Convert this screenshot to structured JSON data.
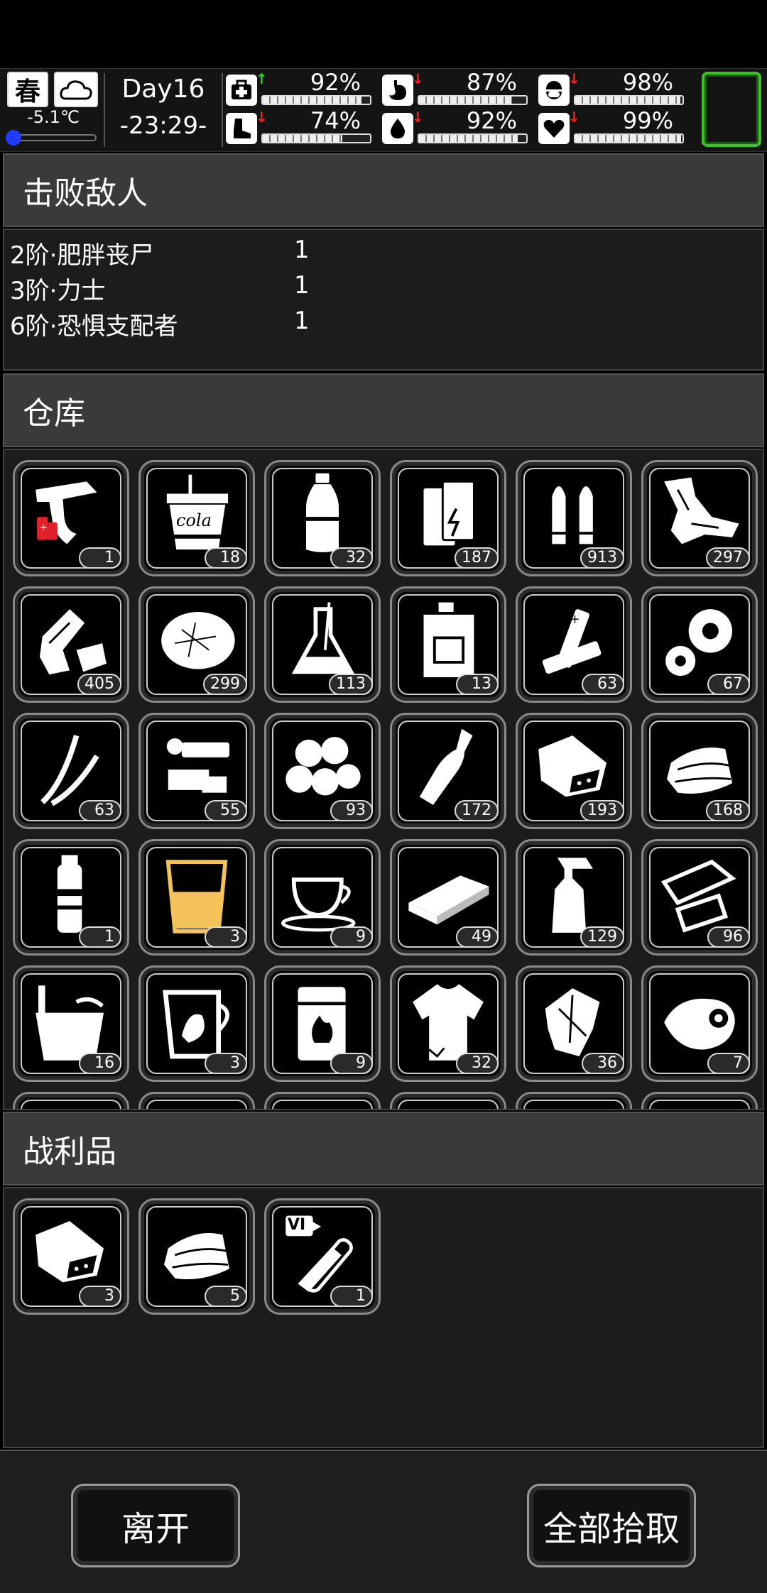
{
  "hud": {
    "season": "春",
    "weather_icon": "cloud-icon",
    "temperature": "-5.1℃",
    "day": "Day16",
    "time": "-23:29-",
    "stats": [
      {
        "name": "health",
        "icon": "medkit-icon",
        "trend": "up",
        "value": "92%",
        "level": 0.92
      },
      {
        "name": "hunger",
        "icon": "stomach-icon",
        "trend": "down",
        "value": "87%",
        "level": 0.87
      },
      {
        "name": "medicine",
        "icon": "pill-icon",
        "trend": "down",
        "value": "98%",
        "level": 0.98
      },
      {
        "name": "stamina",
        "icon": "boot-icon",
        "trend": "down",
        "value": "74%",
        "level": 0.74
      },
      {
        "name": "thirst",
        "icon": "water-drop-icon",
        "trend": "down",
        "value": "92%",
        "level": 0.92
      },
      {
        "name": "mood",
        "icon": "heart-icon",
        "trend": "down",
        "value": "99%",
        "level": 0.99
      }
    ]
  },
  "defeated": {
    "title": "击败敌人",
    "enemies": [
      {
        "name": "2阶·肥胖丧尸",
        "count": "1"
      },
      {
        "name": "3阶·力士",
        "count": "1"
      },
      {
        "name": "6阶·恐惧支配者",
        "count": "1"
      }
    ]
  },
  "storage": {
    "title": "仓库",
    "items": [
      {
        "icon": "flare-gun-icon",
        "qty": "1"
      },
      {
        "icon": "cola-cup-icon",
        "qty": "18",
        "text": "cola"
      },
      {
        "icon": "water-bottle-icon",
        "qty": "32"
      },
      {
        "icon": "battery-pack-icon",
        "qty": "187"
      },
      {
        "icon": "bullets-icon",
        "qty": "913"
      },
      {
        "icon": "scrap-metal-icon",
        "qty": "297"
      },
      {
        "icon": "plastic-waste-icon",
        "qty": "405"
      },
      {
        "icon": "cotton-fluff-icon",
        "qty": "299"
      },
      {
        "icon": "flask-icon",
        "qty": "113"
      },
      {
        "icon": "fuel-canister-icon",
        "qty": "13"
      },
      {
        "icon": "batteries-icon",
        "qty": "63"
      },
      {
        "icon": "gears-icon",
        "qty": "67"
      },
      {
        "icon": "wires-icon",
        "qty": "63"
      },
      {
        "icon": "electronic-parts-icon",
        "qty": "55"
      },
      {
        "icon": "cotton-balls-icon",
        "qty": "93"
      },
      {
        "icon": "glass-bottle-icon",
        "qty": "172"
      },
      {
        "icon": "seed-bag-icon",
        "qty": "193"
      },
      {
        "icon": "cloth-icon",
        "qty": "168"
      },
      {
        "icon": "spray-can-icon",
        "qty": "1"
      },
      {
        "icon": "juice-glass-icon",
        "qty": "3"
      },
      {
        "icon": "coffee-cup-icon",
        "qty": "9"
      },
      {
        "icon": "wood-board-icon",
        "qty": "49"
      },
      {
        "icon": "spray-bottle-icon",
        "qty": "129"
      },
      {
        "icon": "paper-scraps-icon",
        "qty": "96"
      },
      {
        "icon": "bucket-icon",
        "qty": "16"
      },
      {
        "icon": "herb-jar-icon",
        "qty": "3"
      },
      {
        "icon": "fuel-barrel-icon",
        "qty": "9"
      },
      {
        "icon": "torn-shirt-icon",
        "qty": "32"
      },
      {
        "icon": "rag-icon",
        "qty": "36"
      },
      {
        "icon": "meat-icon",
        "qty": "7"
      }
    ]
  },
  "loot": {
    "title": "战利品",
    "items": [
      {
        "icon": "seed-bag-icon",
        "qty": "3"
      },
      {
        "icon": "cloth-icon",
        "qty": "5"
      },
      {
        "icon": "test-tube-icon",
        "qty": "1",
        "text": "VI"
      }
    ]
  },
  "actions": {
    "leave": "离开",
    "take_all": "全部拾取"
  }
}
